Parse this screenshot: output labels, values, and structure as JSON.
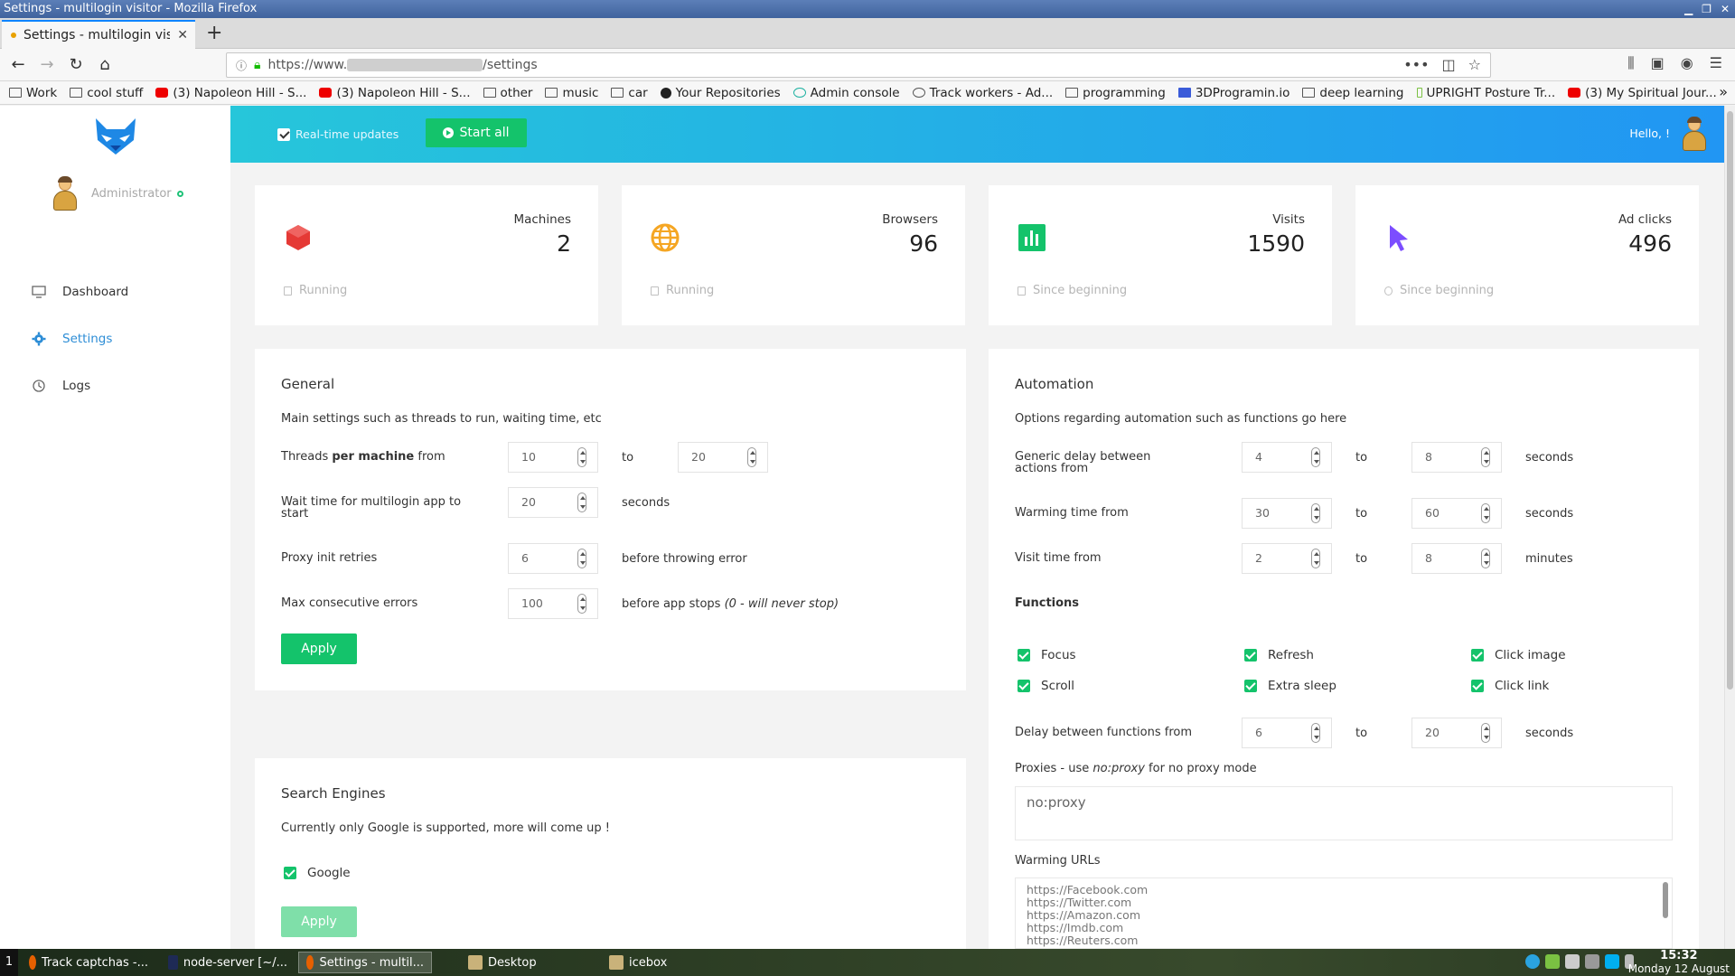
{
  "window": {
    "title": "Settings - multilogin visitor - Mozilla Firefox"
  },
  "browser": {
    "tab_title": "Settings - multilogin visit",
    "url_prefix": "https://www.",
    "url_suffix": "/settings",
    "bookmarks": [
      {
        "label": "Work",
        "icon": "folder-icon"
      },
      {
        "label": "cool stuff",
        "icon": "folder-icon"
      },
      {
        "label": "(3) Napoleon Hill - S...",
        "icon": "youtube-icon"
      },
      {
        "label": "(3) Napoleon Hill - S...",
        "icon": "youtube-icon"
      },
      {
        "label": "other",
        "icon": "folder-icon"
      },
      {
        "label": "music",
        "icon": "folder-icon"
      },
      {
        "label": "car",
        "icon": "folder-icon"
      },
      {
        "label": "Your Repositories",
        "icon": "github-icon"
      },
      {
        "label": "Admin console",
        "icon": "c-icon"
      },
      {
        "label": "Track workers - Ad...",
        "icon": "globe-icon"
      },
      {
        "label": "programming",
        "icon": "folder-icon"
      },
      {
        "label": "3DProgramin.io",
        "icon": "3d-icon"
      },
      {
        "label": "deep learning",
        "icon": "folder-icon"
      },
      {
        "label": "UPRIGHT Posture Tr...",
        "icon": "upright-icon"
      },
      {
        "label": "(3) My Spiritual Jour...",
        "icon": "youtube-icon"
      }
    ]
  },
  "sidebar": {
    "role": "Administrator",
    "items": [
      {
        "label": "Dashboard",
        "icon": "monitor-icon",
        "active": false
      },
      {
        "label": "Settings",
        "icon": "gear-icon",
        "active": true
      },
      {
        "label": "Logs",
        "icon": "history-icon",
        "active": false
      }
    ]
  },
  "banner": {
    "realtime_label": "Real-time updates",
    "start_label": "Start all",
    "hello": "Hello, !"
  },
  "stats": [
    {
      "label": "Machines",
      "value": "2",
      "foot": "Running",
      "color": "#e53935"
    },
    {
      "label": "Browsers",
      "value": "96",
      "foot": "Running",
      "color": "#f5a623"
    },
    {
      "label": "Visits",
      "value": "1590",
      "foot": "Since beginning",
      "color": "#14c36b"
    },
    {
      "label": "Ad clicks",
      "value": "496",
      "foot": "Since beginning",
      "color": "#7c4dff"
    }
  ],
  "general": {
    "title": "General",
    "desc": "Main settings such as threads to run, waiting time, etc",
    "threads_pre": "Threads ",
    "threads_bold": "per machine",
    "threads_post": " from",
    "threads_from": "10",
    "to": "to",
    "threads_to": "20",
    "wait_label": "Wait time for multilogin app to start",
    "wait_value": "20",
    "seconds": "seconds",
    "proxy_label": "Proxy init retries",
    "proxy_value": "6",
    "proxy_suffix": "before throwing error",
    "errors_label": "Max consecutive errors",
    "errors_value": "100",
    "errors_suffix": "before app stops ",
    "errors_note": "(0 - will never stop)",
    "apply": "Apply"
  },
  "search_engines": {
    "title": "Search Engines",
    "desc": "Currently only Google is supported, more will come up !",
    "google": "Google",
    "apply": "Apply"
  },
  "automation": {
    "title": "Automation",
    "desc": "Options regarding automation such as functions go here",
    "generic_label": "Generic delay between actions from",
    "generic_from": "4",
    "generic_to": "8",
    "warming_label": "Warming time from",
    "warming_from": "30",
    "warming_to": "60",
    "visit_label": "Visit time from",
    "visit_from": "2",
    "visit_to": "8",
    "to": "to",
    "seconds": "seconds",
    "minutes": "minutes",
    "functions_title": "Functions",
    "functions": [
      "Focus",
      "Refresh",
      "Click image",
      "Scroll",
      "Extra sleep",
      "Click link"
    ],
    "delay_label": "Delay between functions from",
    "delay_from": "6",
    "delay_to": "20",
    "proxies_pre": "Proxies - use ",
    "proxies_em": "no:proxy",
    "proxies_post": " for no proxy mode",
    "proxies_value": "no:proxy",
    "warming_urls_label": "Warming URLs",
    "warming_urls": [
      "https://Facebook.com",
      "https://Twitter.com",
      "https://Amazon.com",
      "https://Imdb.com",
      "https://Reuters.com"
    ]
  },
  "taskbar": {
    "workspace": "1",
    "tasks": [
      "Track captchas -...",
      "node-server [~/...",
      "Settings - multil...",
      "Desktop",
      "icebox"
    ],
    "time": "15:32",
    "date": "Monday 12 August"
  }
}
